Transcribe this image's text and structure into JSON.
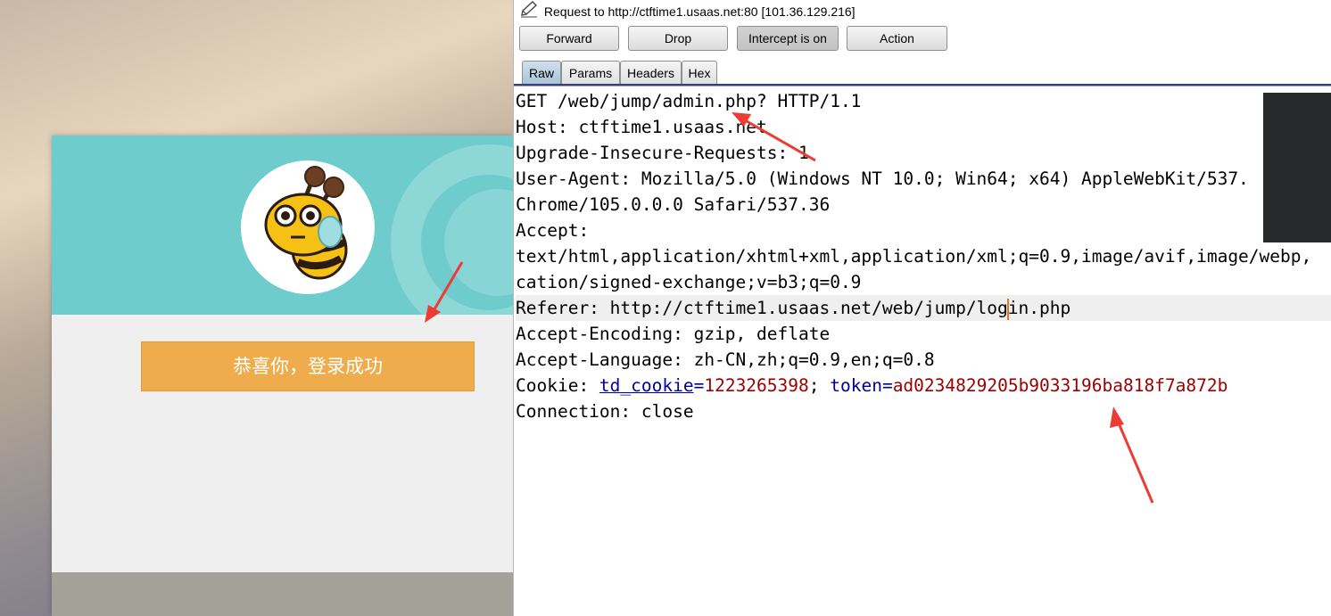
{
  "browser_page": {
    "success_button_label": "恭喜你，登录成功"
  },
  "burp": {
    "request_title": "Request to http://ctftime1.usaas.net:80  [101.36.129.216]",
    "buttons": {
      "forward": "Forward",
      "drop": "Drop",
      "intercept": "Intercept is on",
      "action": "Action"
    },
    "tabs": {
      "raw": "Raw",
      "params": "Params",
      "headers": "Headers",
      "hex": "Hex"
    },
    "request_lines": {
      "l1": "GET /web/jump/admin.php? HTTP/1.1",
      "l2": "Host: ctftime1.usaas.net",
      "l3": "Upgrade-Insecure-Requests: 1",
      "l4": "User-Agent: Mozilla/5.0 (Windows NT 10.0; Win64; x64) AppleWebKit/537.",
      "l5": "Chrome/105.0.0.0 Safari/537.36",
      "l6": "Accept:",
      "l7": "text/html,application/xhtml+xml,application/xml;q=0.9,image/avif,image/webp,",
      "l8": "cation/signed-exchange;v=b3;q=0.9",
      "l9a": "Referer: http://ctftime1.usaas.net/web/jump/log",
      "l9b": "in.php",
      "l10": "Accept-Encoding: gzip, deflate",
      "l11": "Accept-Language: zh-CN,zh;q=0.9,en;q=0.8",
      "l13": "Connection: close"
    },
    "cookie": {
      "prefix": "Cookie: ",
      "name1": "td_cookie",
      "eq1": "=",
      "value1": "1223265398",
      "sep": "; ",
      "name2": "token",
      "eq2": "=",
      "value2": "ad0234829205b9033196ba818f7a872b"
    }
  },
  "colors": {
    "header_teal": "#6ecccc",
    "success_orange": "#efac4c",
    "cookie_name_blue": "#000099",
    "cookie_value_red": "#990000",
    "annotation_red": "#ee3b33"
  }
}
